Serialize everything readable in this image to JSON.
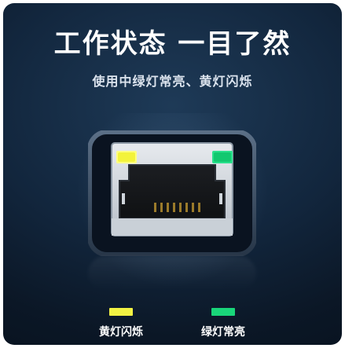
{
  "header": {
    "title": "工作状态 一目了然",
    "subtitle": "使用中绿灯常亮、黄灯闪烁"
  },
  "legend": {
    "yellow_label": "黄灯闪烁",
    "green_label": "绿灯常亮"
  },
  "colors": {
    "yellow_led": "#f2f243",
    "green_led": "#19d67a"
  },
  "icons": {
    "port": "ethernet-port-icon"
  }
}
